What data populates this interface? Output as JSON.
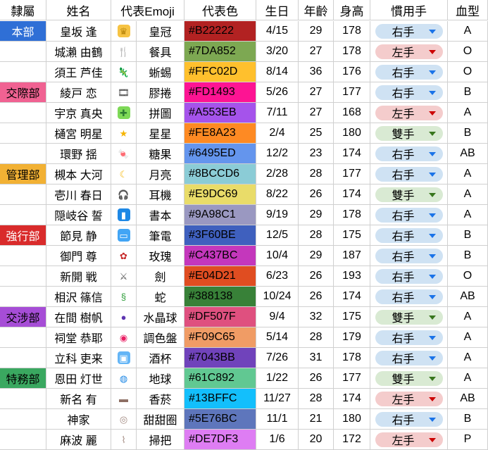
{
  "headers": [
    "隸屬",
    "姓名",
    "代表Emoji",
    "",
    "代表色",
    "生日",
    "年齡",
    "身高",
    "慣用手",
    "血型"
  ],
  "hands": {
    "右手": {
      "bg": "#cfe2f3",
      "arrow": "#1a73e8"
    },
    "左手": {
      "bg": "#f4cccc",
      "arrow": "#cc0000"
    },
    "雙手": {
      "bg": "#d9ead3",
      "arrow": "#38761d"
    }
  },
  "rows": [
    {
      "dept": "本部",
      "dept_color": "#2f6fd6",
      "dept_text": "#ffffff",
      "name": "皇坂 逢",
      "icon": "crown-icon",
      "glyph": "♛",
      "glyph_bg": "#f6c343",
      "glyph_fg": "#b8860b",
      "item": "皇冠",
      "color": "#B22222",
      "color_text": "#000000",
      "bday": "4/15",
      "age": "29",
      "height": "178",
      "hand": "右手",
      "blood": "A"
    },
    {
      "dept": "",
      "name": "城瀨 由鶴",
      "icon": "fork-knife-icon",
      "glyph": "🍴",
      "glyph_bg": "#ffffff",
      "glyph_fg": "#555555",
      "item": "餐具",
      "color": "#7DA852",
      "color_text": "#000000",
      "bday": "3/20",
      "age": "27",
      "height": "178",
      "hand": "左手",
      "blood": "O"
    },
    {
      "dept": "",
      "name": "須王 芦佳",
      "icon": "lizard-icon",
      "glyph": "🦎",
      "glyph_bg": "#ffffff",
      "glyph_fg": "#2e9d3a",
      "item": "蜥蜴",
      "color": "#FFC02D",
      "color_text": "#000000",
      "bday": "8/14",
      "age": "36",
      "height": "176",
      "hand": "右手",
      "blood": "O"
    },
    {
      "dept": "交際部",
      "dept_color": "#f06292",
      "dept_text": "#000000",
      "name": "綾戸 恋",
      "icon": "film-icon",
      "glyph": "🎞",
      "glyph_bg": "#ffffff",
      "glyph_fg": "#333333",
      "item": "膠捲",
      "color": "#FD1493",
      "color_text": "#000000",
      "bday": "5/26",
      "age": "27",
      "height": "177",
      "hand": "右手",
      "blood": "B"
    },
    {
      "dept": "",
      "name": "宇京 真央",
      "icon": "puzzle-icon",
      "glyph": "✚",
      "glyph_bg": "#7ed957",
      "glyph_fg": "#2e7d32",
      "item": "拼圖",
      "color": "#A553EB",
      "color_text": "#000000",
      "bday": "7/11",
      "age": "27",
      "height": "168",
      "hand": "左手",
      "blood": "A"
    },
    {
      "dept": "",
      "name": "樋宮 明星",
      "icon": "star-icon",
      "glyph": "★",
      "glyph_bg": "#ffffff",
      "glyph_fg": "#f5b400",
      "item": "星星",
      "color": "#FE8A23",
      "color_text": "#000000",
      "bday": "2/4",
      "age": "25",
      "height": "180",
      "hand": "雙手",
      "blood": "B"
    },
    {
      "dept": "",
      "name": "環野 揺",
      "icon": "candy-icon",
      "glyph": "🍬",
      "glyph_bg": "#ffffff",
      "glyph_fg": "#e53935",
      "item": "糖果",
      "color": "#6495ED",
      "color_text": "#000000",
      "bday": "12/2",
      "age": "23",
      "height": "174",
      "hand": "右手",
      "blood": "AB"
    },
    {
      "dept": "管理部",
      "dept_color": "#f2b134",
      "dept_text": "#000000",
      "name": "槻本 大河",
      "icon": "moon-icon",
      "glyph": "☾",
      "glyph_bg": "#ffffff",
      "glyph_fg": "#f5b400",
      "item": "月亮",
      "color": "#8BCCD6",
      "color_text": "#000000",
      "bday": "2/28",
      "age": "28",
      "height": "177",
      "hand": "右手",
      "blood": "A"
    },
    {
      "dept": "",
      "name": "壱川 春日",
      "icon": "headphones-icon",
      "glyph": "🎧",
      "glyph_bg": "#ffffff",
      "glyph_fg": "#444444",
      "item": "耳機",
      "color": "#E9DC69",
      "color_text": "#000000",
      "bday": "8/22",
      "age": "26",
      "height": "174",
      "hand": "雙手",
      "blood": "A"
    },
    {
      "dept": "",
      "name": "隠岐谷 誓",
      "icon": "book-icon",
      "glyph": "▮",
      "glyph_bg": "#1e88e5",
      "glyph_fg": "#ffffff",
      "item": "書本",
      "color": "#9A98C1",
      "color_text": "#000000",
      "bday": "9/19",
      "age": "29",
      "height": "178",
      "hand": "右手",
      "blood": "A"
    },
    {
      "dept": "強行部",
      "dept_color": "#d92b2b",
      "dept_text": "#ffffff",
      "name": "節見 静",
      "icon": "laptop-icon",
      "glyph": "▭",
      "glyph_bg": "#42a5f5",
      "glyph_fg": "#ffffff",
      "item": "筆電",
      "color": "#3F60BE",
      "color_text": "#000000",
      "bday": "12/5",
      "age": "28",
      "height": "175",
      "hand": "右手",
      "blood": "B"
    },
    {
      "dept": "",
      "name": "御門 尊",
      "icon": "rose-icon",
      "glyph": "✿",
      "glyph_bg": "#ffffff",
      "glyph_fg": "#c62828",
      "item": "玫瑰",
      "color": "#C437BC",
      "color_text": "#000000",
      "bday": "10/4",
      "age": "29",
      "height": "187",
      "hand": "右手",
      "blood": "B"
    },
    {
      "dept": "",
      "name": "新開 戦",
      "icon": "crossed-swords-icon",
      "glyph": "⚔",
      "glyph_bg": "#ffffff",
      "glyph_fg": "#555555",
      "item": "劍",
      "color": "#E04D21",
      "color_text": "#000000",
      "bday": "6/23",
      "age": "26",
      "height": "193",
      "hand": "右手",
      "blood": "O"
    },
    {
      "dept": "",
      "name": "相沢 篠信",
      "icon": "snake-icon",
      "glyph": "§",
      "glyph_bg": "#ffffff",
      "glyph_fg": "#2e9d3a",
      "item": "蛇",
      "color": "#388138",
      "color_text": "#000000",
      "bday": "10/24",
      "age": "26",
      "height": "174",
      "hand": "右手",
      "blood": "AB"
    },
    {
      "dept": "交涉部",
      "dept_color": "#a64dd6",
      "dept_text": "#000000",
      "name": "在間 樹帆",
      "icon": "crystal-ball-icon",
      "glyph": "●",
      "glyph_bg": "#ffffff",
      "glyph_fg": "#5e35b1",
      "item": "水晶球",
      "color": "#DF507F",
      "color_text": "#000000",
      "bday": "9/4",
      "age": "32",
      "height": "175",
      "hand": "雙手",
      "blood": "A"
    },
    {
      "dept": "",
      "name": "祠堂 恭耶",
      "icon": "palette-icon",
      "glyph": "◉",
      "glyph_bg": "#ffffff",
      "glyph_fg": "#e91e63",
      "item": "調色盤",
      "color": "#F09C65",
      "color_text": "#000000",
      "bday": "5/14",
      "age": "28",
      "height": "179",
      "hand": "右手",
      "blood": "A"
    },
    {
      "dept": "",
      "name": "立科 吏来",
      "icon": "wine-glass-icon",
      "glyph": "▣",
      "glyph_bg": "#64b5f6",
      "glyph_fg": "#ffffff",
      "item": "酒杯",
      "color": "#7043BB",
      "color_text": "#000000",
      "bday": "7/26",
      "age": "31",
      "height": "178",
      "hand": "右手",
      "blood": "A"
    },
    {
      "dept": "特務部",
      "dept_color": "#3aa860",
      "dept_text": "#000000",
      "name": "恩田 灯世",
      "icon": "globe-icon",
      "glyph": "◍",
      "glyph_bg": "#ffffff",
      "glyph_fg": "#1e88e5",
      "item": "地球",
      "color": "#61C892",
      "color_text": "#000000",
      "bday": "1/22",
      "age": "26",
      "height": "177",
      "hand": "雙手",
      "blood": "A"
    },
    {
      "dept": "",
      "name": "新名 有",
      "icon": "cigarette-icon",
      "glyph": "▬",
      "glyph_bg": "#ffffff",
      "glyph_fg": "#8d6e63",
      "item": "香菸",
      "color": "#13BFFC",
      "color_text": "#000000",
      "bday": "11/27",
      "age": "28",
      "height": "174",
      "hand": "左手",
      "blood": "AB"
    },
    {
      "dept": "",
      "name": "神家",
      "icon": "donut-icon",
      "glyph": "◎",
      "glyph_bg": "#ffffff",
      "glyph_fg": "#a1887f",
      "item": "甜甜圈",
      "color": "#5E76BC",
      "color_text": "#000000",
      "bday": "11/1",
      "age": "21",
      "height": "180",
      "hand": "右手",
      "blood": "B"
    },
    {
      "dept": "",
      "name": "麻波 麗",
      "icon": "broom-icon",
      "glyph": "⌇",
      "glyph_bg": "#ffffff",
      "glyph_fg": "#a1887f",
      "item": "掃把",
      "color": "#DE7DF3",
      "color_text": "#000000",
      "bday": "1/6",
      "age": "20",
      "height": "172",
      "hand": "左手",
      "blood": "P"
    }
  ]
}
